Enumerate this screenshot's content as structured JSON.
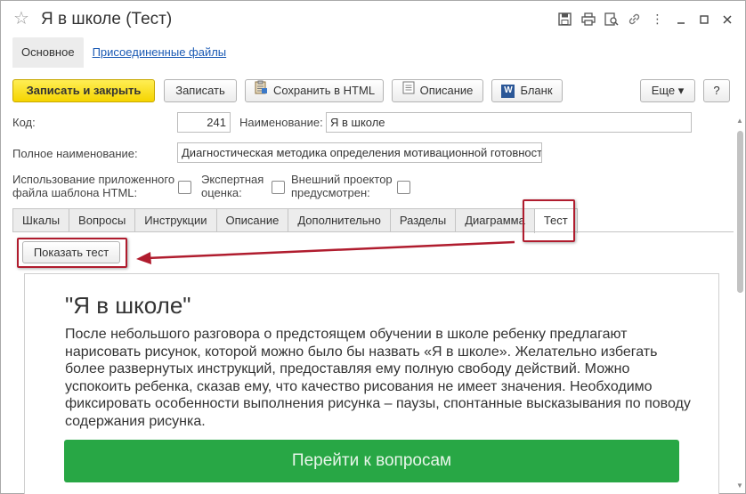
{
  "window": {
    "title": "Я в школе (Тест)"
  },
  "section_tabs": [
    {
      "label": "Основное"
    },
    {
      "label": "Присоединенные файлы"
    }
  ],
  "toolbar": {
    "save_close_label": "Записать и закрыть",
    "save_label": "Записать",
    "save_html_label": "Сохранить в HTML",
    "description_label": "Описание",
    "blank_label": "Бланк",
    "more_label": "Еще ▾",
    "help_label": "?"
  },
  "form": {
    "code_label": "Код:",
    "code_value": "241",
    "name_label": "Наименование:",
    "name_value": "Я в школе",
    "full_name_label": "Полное наименование:",
    "full_name_value": "Диагностическая методика определения мотивационной готовност",
    "html_template_label_1": "Использование приложенного",
    "html_template_label_2": "файла шаблона HTML:",
    "expert_label_1": "Экспертная",
    "expert_label_2": "оценка:",
    "projector_label_1": "Внешний проектор",
    "projector_label_2": "предусмотрен:"
  },
  "page_tabs": [
    {
      "label": "Шкалы"
    },
    {
      "label": "Вопросы"
    },
    {
      "label": "Инструкции"
    },
    {
      "label": "Описание"
    },
    {
      "label": "Дополнительно"
    },
    {
      "label": "Разделы"
    },
    {
      "label": "Диаграмма"
    },
    {
      "label": "Тест"
    }
  ],
  "test_tab": {
    "show_test_label": "Показать тест",
    "heading": "\"Я в школе\"",
    "body": "После небольшого разговора о предстоящем обучении в школе ребенку предлагают нарисовать рисунок, которой можно было бы назвать «Я в школе». Желательно избегать более развернутых инструкций, предоставляя ему полную свободу действий. Можно успокоить ребенка, сказав ему, что качество рисования не имеет значения. Необходимо фиксировать особенности выполнения рисунка – паузы, спонтанные высказывания по поводу содержания рисунка.",
    "go_button_label": "Перейти к вопросам"
  },
  "colors": {
    "primary_button": "#f5d400",
    "link": "#1b5ab4",
    "annotation_red": "#b01c2e",
    "go_button": "#28a745"
  }
}
